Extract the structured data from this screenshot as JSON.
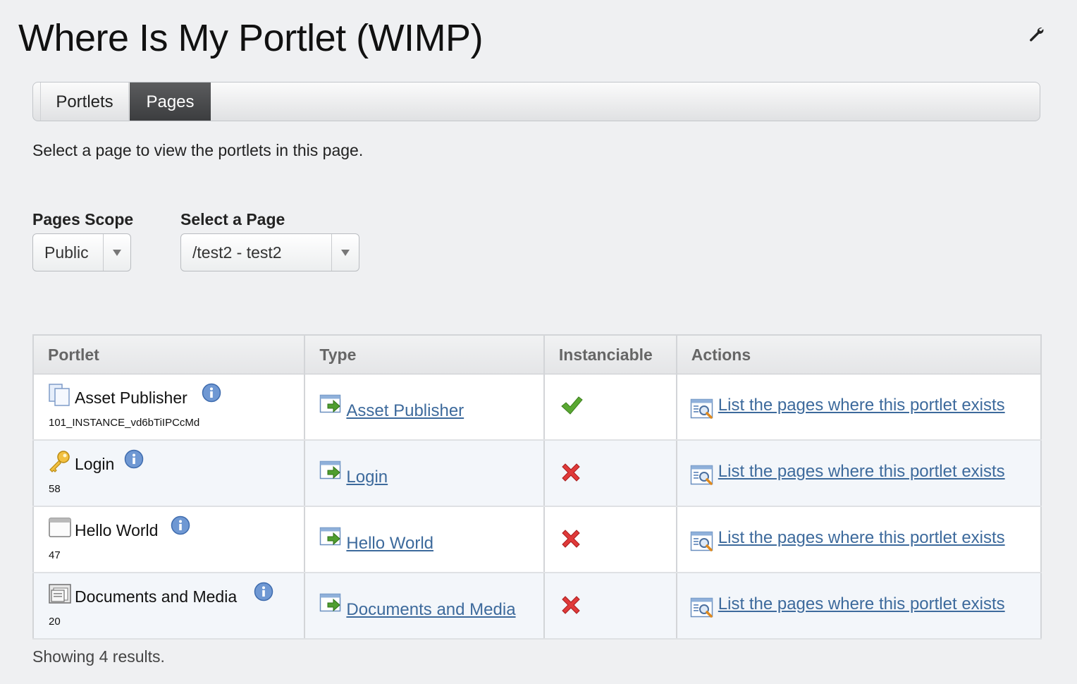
{
  "page_title": "Where Is My Portlet (WIMP)",
  "tabs": [
    {
      "label": "Portlets",
      "active": false
    },
    {
      "label": "Pages",
      "active": true
    }
  ],
  "intro_text": "Select a page to view the portlets in this page.",
  "pages_scope": {
    "label": "Pages Scope",
    "value": "Public"
  },
  "select_page": {
    "label": "Select a Page",
    "value": "/test2 - test2"
  },
  "table": {
    "columns": [
      "Portlet",
      "Type",
      "Instanciable",
      "Actions"
    ],
    "rows": [
      {
        "name": "Asset Publisher",
        "id": "101_INSTANCE_vd6bTiIPCcMd",
        "icon": "asset-publisher-icon",
        "type": "Asset Publisher",
        "instanciable": true,
        "action": "List the pages where this portlet exists"
      },
      {
        "name": "Login",
        "id": "58",
        "icon": "key-icon",
        "type": "Login",
        "instanciable": false,
        "action": "List the pages where this portlet exists"
      },
      {
        "name": "Hello World",
        "id": "47",
        "icon": "window-icon",
        "type": "Hello World",
        "instanciable": false,
        "action": "List the pages where this portlet exists"
      },
      {
        "name": "Documents and Media",
        "id": "20",
        "icon": "documents-icon",
        "type": "Documents and Media",
        "instanciable": false,
        "action": "List the pages where this portlet exists"
      }
    ]
  },
  "footer_text": "Showing 4 results.",
  "colors": {
    "link": "#3d6a9c",
    "active_tab": "#4a4b4d",
    "check": "#5aa832",
    "cross": "#e03a3a"
  }
}
